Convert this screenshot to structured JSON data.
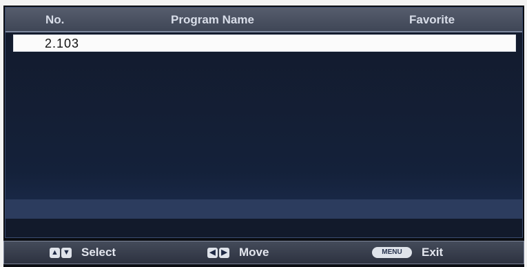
{
  "columns": {
    "no": "No.",
    "program_name": "Program Name",
    "favorite": "Favorite"
  },
  "rows": [
    {
      "no": "2.103",
      "program_name": "",
      "favorite": "",
      "selected": true
    }
  ],
  "footer": {
    "select_label": "Select",
    "move_label": "Move",
    "menu_key": "MENU",
    "exit_label": "Exit"
  }
}
